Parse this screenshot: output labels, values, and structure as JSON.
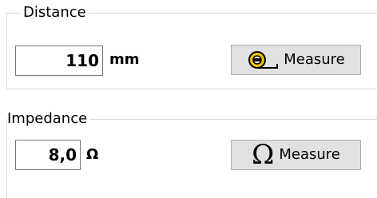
{
  "distance": {
    "legend": "Distance",
    "value": "110",
    "unit": "mm",
    "measure_label": "Measure",
    "icon": "tape-measure-icon"
  },
  "impedance": {
    "legend": "Impedance",
    "value": "8,0",
    "unit": "Ω",
    "measure_label": "Measure",
    "icon": "ohm-icon",
    "icon_glyph": "Ω"
  },
  "colors": {
    "button_face": "#e1e1e1",
    "button_border": "#adadad",
    "group_border": "#d8d8d8",
    "tape_yellow": "#f2c200"
  }
}
